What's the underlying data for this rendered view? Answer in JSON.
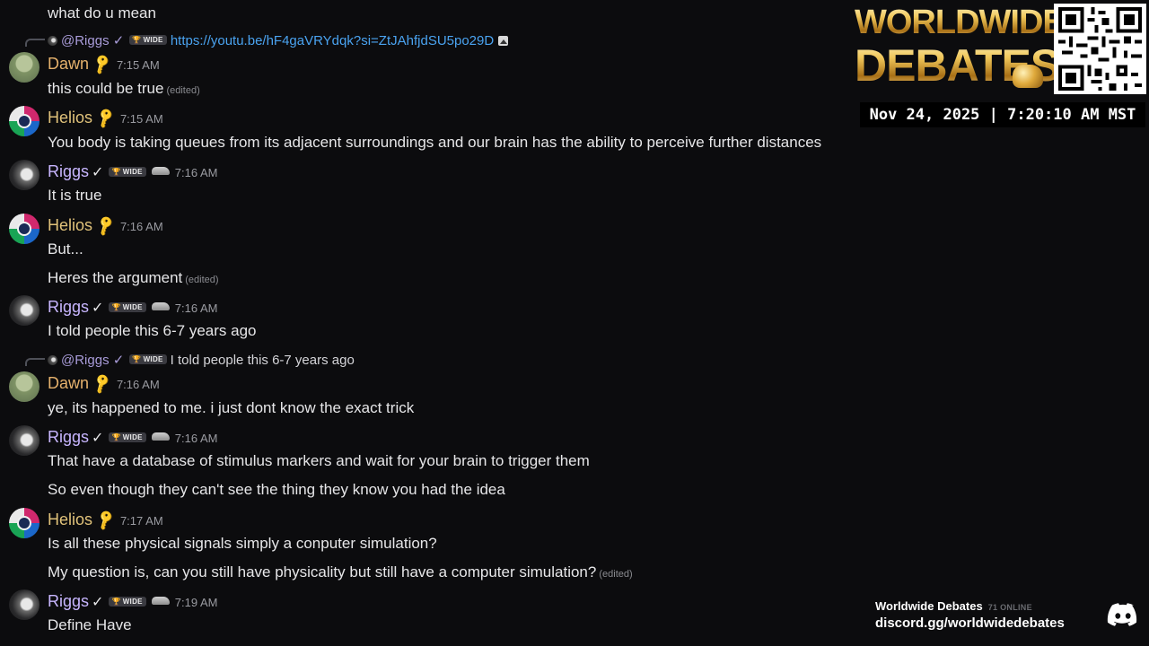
{
  "colors": {
    "background": "#0c0c0e",
    "text": "#e6e6e8",
    "dawn": "#e5b16c",
    "helios": "#e0c27a",
    "riggs": "#c8b6ff",
    "link": "#4aa3f0",
    "timestamp": "#9a9ba1"
  },
  "messages": {
    "top": {
      "text": "what do u mean"
    },
    "m1": {
      "reply": {
        "name": "@Riggs ✓",
        "tag": "WIDE",
        "text": "https://youtu.be/hF4gaVRYdqk?si=ZtJAhfjdSU5po29D"
      },
      "author": "Dawn",
      "time": "7:15 AM",
      "text": "this could be true",
      "edited": "(edited)"
    },
    "m2": {
      "author": "Helios",
      "time": "7:15 AM",
      "text": "You body is taking queues from its adjacent surroundings and our brain has the ability to perceive further distances"
    },
    "m3": {
      "author": "Riggs",
      "tag": "WIDE",
      "time": "7:16 AM",
      "text": "It is true"
    },
    "m4": {
      "author": "Helios",
      "time": "7:16 AM",
      "text": "But...",
      "text2": "Heres the argument",
      "edited": "(edited)"
    },
    "m5": {
      "author": "Riggs",
      "tag": "WIDE",
      "time": "7:16 AM",
      "text": "I told people this 6-7 years ago"
    },
    "m6": {
      "reply": {
        "name": "@Riggs ✓",
        "tag": "WIDE",
        "text": "I told people this 6-7 years ago"
      },
      "author": "Dawn",
      "time": "7:16 AM",
      "text": "ye, its happened to me. i just dont know the exact trick"
    },
    "m7": {
      "author": "Riggs",
      "tag": "WIDE",
      "time": "7:16 AM",
      "text": "That have a database of stimulus markers and wait for your brain to trigger them",
      "text2": "So even though they can't see the thing they know you had the idea"
    },
    "m8": {
      "author": "Helios",
      "time": "7:17 AM",
      "text": "Is all these physical signals simply a conputer simulation?",
      "text2": "My question is, can you still have physicality but still have a computer simulation?",
      "edited": "(edited)"
    },
    "m9": {
      "author": "Riggs",
      "tag": "WIDE",
      "time": "7:19 AM",
      "text": "Define Have"
    }
  },
  "overlay": {
    "logo_line1": "WORLDWIDE",
    "logo_line2": "DEBATES",
    "datetime": "Nov 24, 2025 | 7:20:10 AM MST",
    "server_name": "Worldwide Debates",
    "online": "71 ONLINE",
    "invite": "discord.gg/worldwidedebates"
  },
  "icons": {
    "key": "key-icon",
    "verified": "checkmark-icon",
    "badge": "trophy-wide-badge",
    "shoe": "sneaker-icon",
    "image": "image-icon",
    "discord": "discord-logo-icon",
    "qr": "qr-code"
  }
}
